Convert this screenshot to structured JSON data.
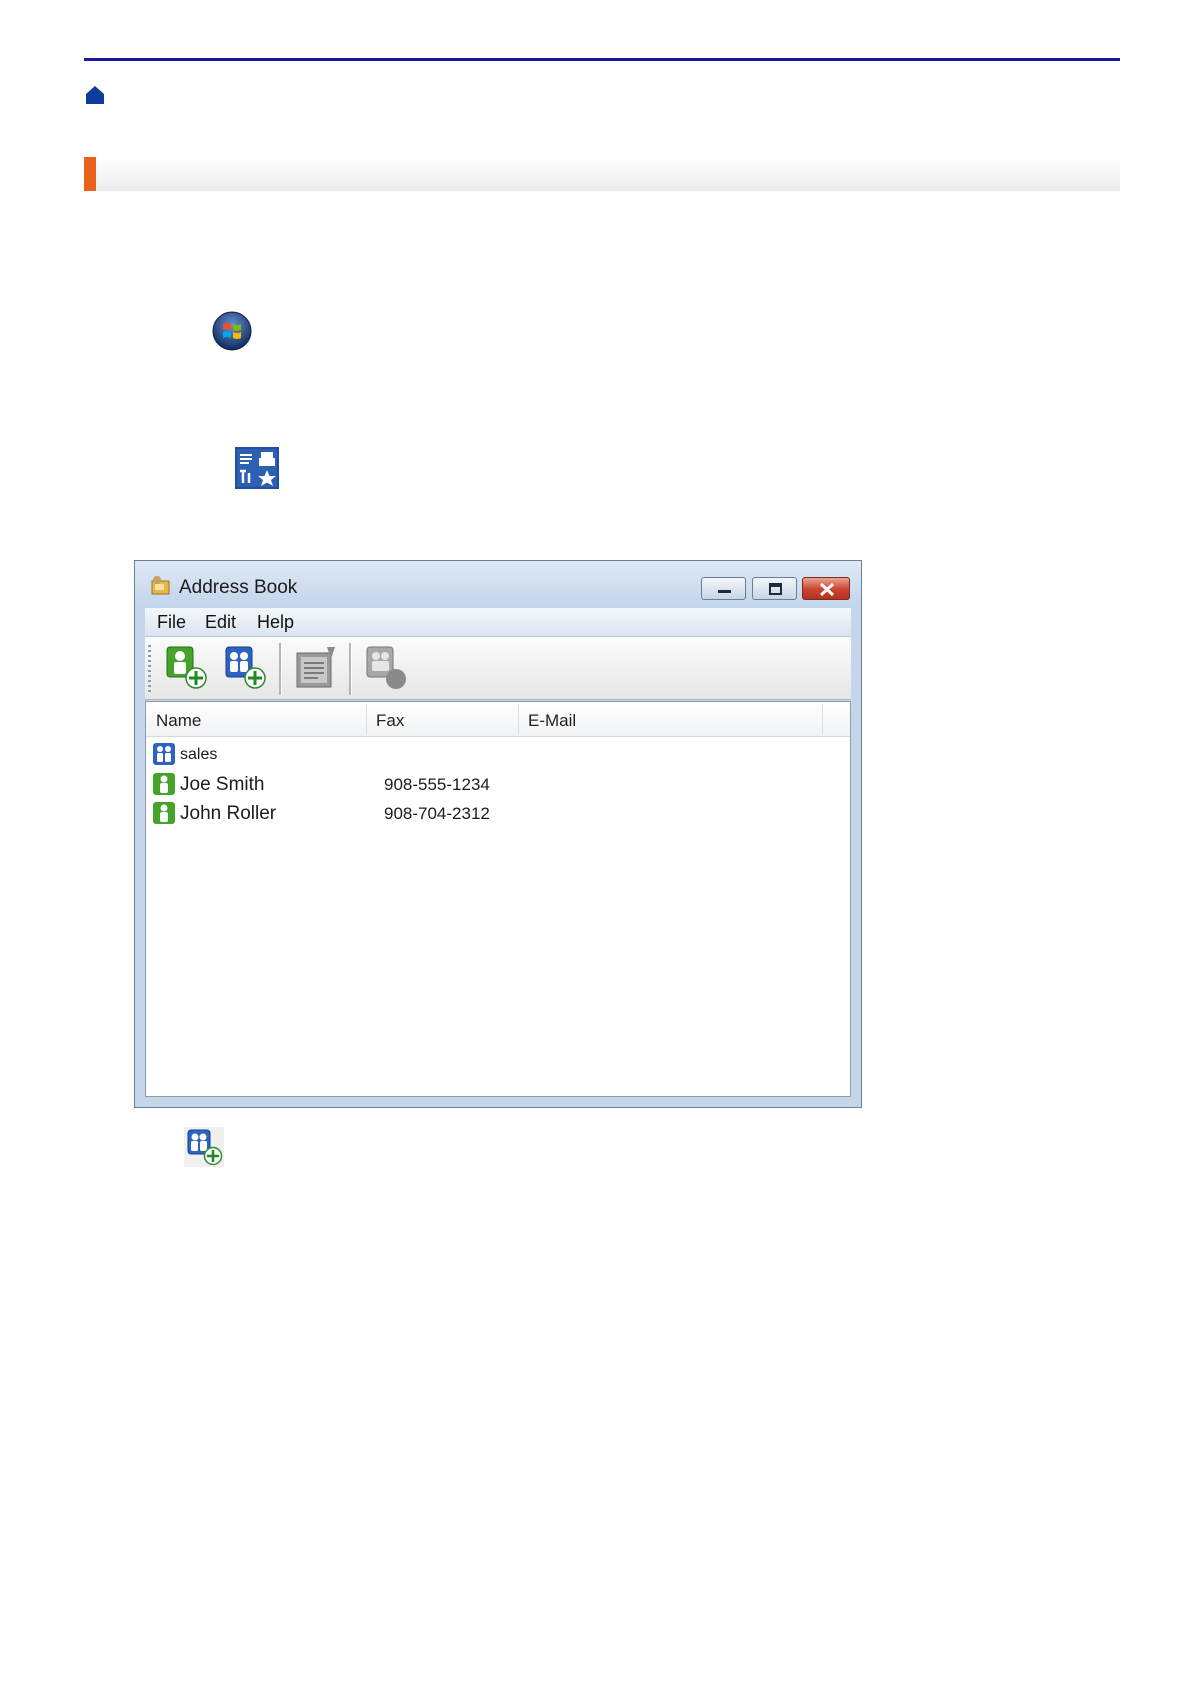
{
  "window": {
    "title": "Address Book",
    "menu": {
      "file": "File",
      "edit": "Edit",
      "help": "Help"
    }
  },
  "list": {
    "columns": {
      "name": "Name",
      "fax": "Fax",
      "email": "E-Mail"
    },
    "rows": [
      {
        "name": "sales",
        "fax": "",
        "email": "",
        "icon": "group-icon"
      },
      {
        "name": "Joe Smith",
        "fax": "908-555-1234",
        "email": "",
        "icon": "person-icon"
      },
      {
        "name": "John Roller",
        "fax": "908-704-2312",
        "email": "",
        "icon": "person-icon"
      }
    ]
  },
  "colors": {
    "top_rule": "#1a1aa6",
    "section_accent": "#e8611a"
  }
}
